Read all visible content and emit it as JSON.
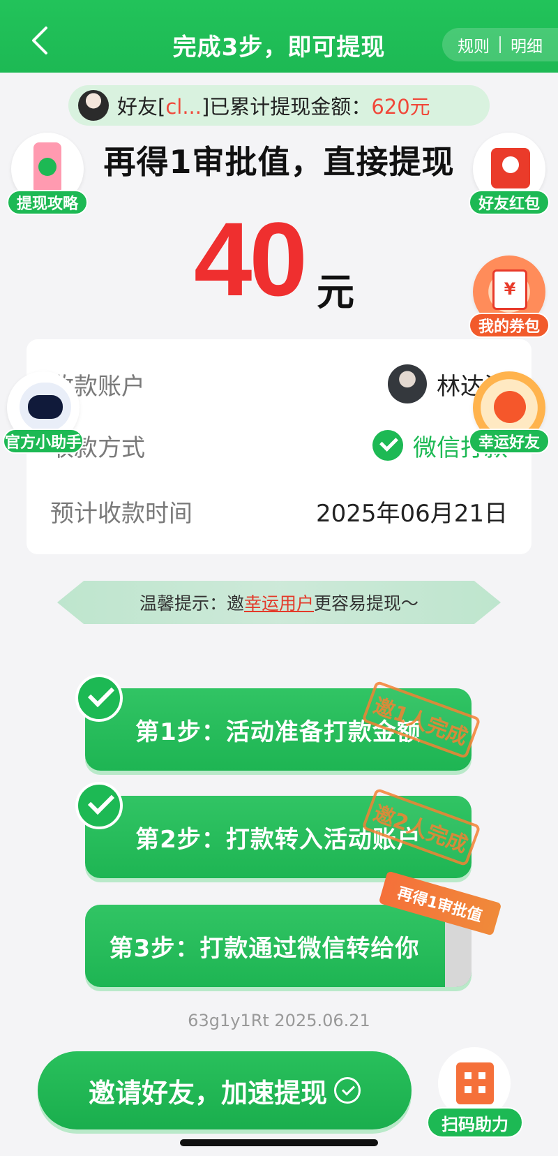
{
  "header": {
    "title": "完成3步，即可提现",
    "rules": "规则",
    "details": "明细"
  },
  "banner": {
    "prefix": "好友[",
    "name": "cl...",
    "middle": "]已累计提现金额：",
    "amount": "620元"
  },
  "headline": "再得1审批值，直接提现",
  "amount": {
    "value": "40",
    "unit": "元"
  },
  "account": {
    "rows": [
      {
        "label": "收款账户",
        "value": "林达浩"
      },
      {
        "label": "收款方式",
        "value": "微信打款"
      },
      {
        "label": "预计收款时间",
        "value": "2025年06月21日"
      }
    ]
  },
  "floats": {
    "guide": "提现攻略",
    "redpack": "好友红包",
    "coupon": "我的券包",
    "coupon_symbol": "¥",
    "helper": "官方小助手",
    "lucky": "幸运好友"
  },
  "tip": {
    "prefix": "温馨提示：邀",
    "highlight": "幸运用户",
    "suffix": "更容易提现～"
  },
  "steps": [
    {
      "label": "第1步：活动准备打款金额",
      "stamp": "邀1人完成",
      "done": true
    },
    {
      "label": "第2步：打款转入活动账户",
      "stamp": "邀2人完成",
      "done": true
    },
    {
      "label": "第3步：打款通过微信转给你",
      "ribbon": "再得1审批值",
      "done": false
    }
  ],
  "footer_id": "63g1y1Rt 2025.06.21",
  "invite_button": "邀请好友，加速提现",
  "scan_help": "扫码助力",
  "colors": {
    "primary": "#1db954",
    "accent_red": "#ef2f2f",
    "stamp_orange": "#f58234"
  }
}
